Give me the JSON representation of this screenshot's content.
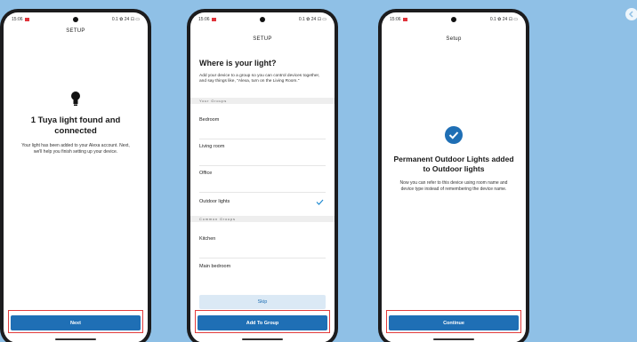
{
  "status": {
    "time": "15:06",
    "right": "0.1 ✿ 24 ⊡ ▭"
  },
  "screen1": {
    "title": "SETUP",
    "heading": "1 Tuya light found and connected",
    "body": "Your light has been added to your Alexa account. Next, we'll help you finish setting up your device.",
    "button": "Next"
  },
  "screen2": {
    "title": "SETUP",
    "heading": "Where is your light?",
    "body": "Add your device to a group so you can control devices together, and say things like, \"Alexa, turn on the Living Room.\"",
    "your_groups_label": "Your Groups",
    "your_groups": [
      "Bedroom",
      "Living room",
      "Office",
      "Outdoor lights"
    ],
    "selected_group": "Outdoor lights",
    "common_groups_label": "Common Groups",
    "common_groups": [
      "Kitchen",
      "Main bedroom"
    ],
    "skip": "Skip",
    "button": "Add To Group"
  },
  "screen3": {
    "title": "Setup",
    "heading": "Permanent Outdoor Lights added to Outdoor lights",
    "body": "Now you can refer to this device using room name and device type instead of remembering the device name.",
    "button": "Continue"
  },
  "colors": {
    "accent": "#1f6fb5",
    "highlight": "#e23b3b",
    "background": "#8fc0e6"
  }
}
